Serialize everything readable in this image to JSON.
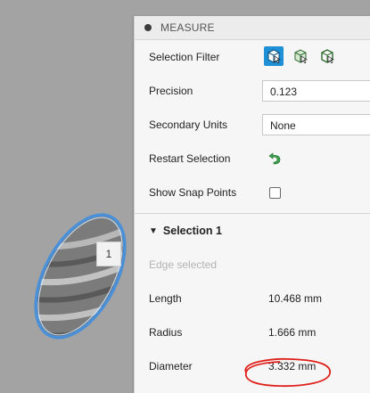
{
  "panel": {
    "title": "MEASURE",
    "selection_filter": {
      "label": "Selection Filter",
      "icons": [
        "select-body-icon",
        "select-face-icon",
        "select-edge-icon"
      ],
      "active_index": 0
    },
    "precision": {
      "label": "Precision",
      "value": "0.123"
    },
    "secondary_units": {
      "label": "Secondary Units",
      "value": "None"
    },
    "restart_selection": {
      "label": "Restart Selection",
      "icon": "restart-arrow-icon"
    },
    "show_snap_points": {
      "label": "Show Snap Points",
      "checked": false
    }
  },
  "selection": {
    "title": "Selection 1",
    "status": "Edge selected",
    "measurements": [
      {
        "label": "Length",
        "value": "10.468 mm"
      },
      {
        "label": "Radius",
        "value": "1.666 mm"
      },
      {
        "label": "Diameter",
        "value": "3.332 mm"
      }
    ]
  },
  "viewport": {
    "marker_label": "1"
  },
  "colors": {
    "accent": "#1f8fd6",
    "edge_highlight": "#4a90d9",
    "annotation": "#e0201b",
    "restart_icon": "#3aa04a"
  }
}
